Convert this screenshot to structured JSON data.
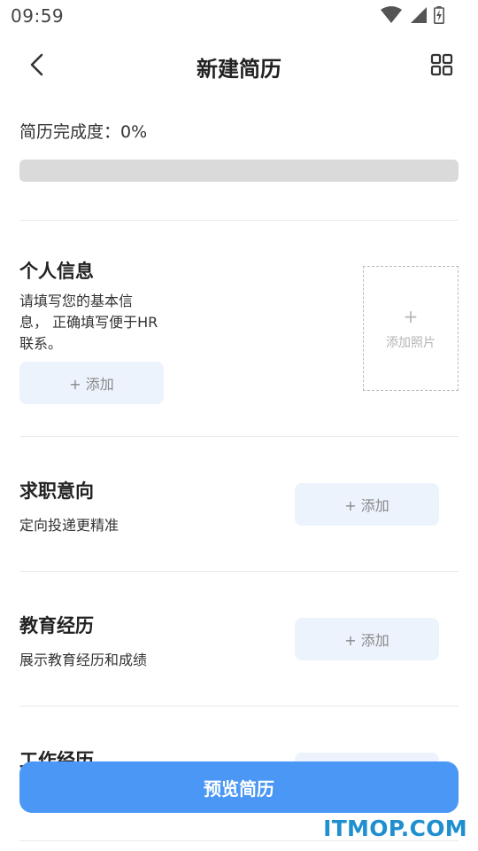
{
  "status_bar": {
    "time": "09:59",
    "icons": [
      "wifi-icon",
      "signal-icon",
      "battery-charging-icon"
    ]
  },
  "nav": {
    "back_icon": "chevron-left-icon",
    "title": "新建简历",
    "grid_icon": "grid-icon"
  },
  "progress": {
    "label": "简历完成度：0%",
    "percent": 0
  },
  "sections": {
    "personal": {
      "title": "个人信息",
      "desc_line1": "请填写您的基本信",
      "desc_line2": "息， 正确填写便于HR",
      "desc_line3": "联系。",
      "add_label": "+ 添加",
      "photo_plus": "+",
      "photo_label": "添加照片"
    },
    "intention": {
      "title": "求职意向",
      "desc": "定向投递更精准",
      "add_label": "+ 添加"
    },
    "education": {
      "title": "教育经历",
      "desc": "展示教育经历和成绩",
      "add_label": "+ 添加"
    },
    "work": {
      "title": "工作经历"
    }
  },
  "preview_button": "预览简历",
  "watermark": "ITMOP.COM",
  "colors": {
    "accent": "#4a97f5",
    "add_button_bg": "#edf3fd",
    "progress_track": "#dadada",
    "watermark": "#1f8fd0"
  }
}
